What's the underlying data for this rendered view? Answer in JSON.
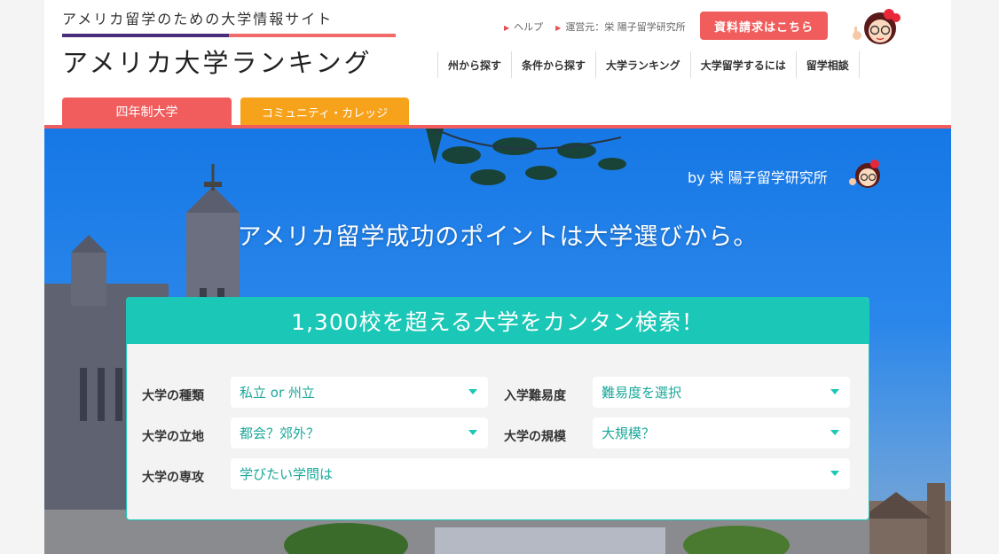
{
  "header": {
    "logo_sub": "アメリカ留学のための大学情報サイト",
    "logo_main": "アメリカ大学ランキング",
    "help_link": "ヘルプ",
    "operator_link": "運営元：栄 陽子留学研究所",
    "request_button": "資料請求はこちら"
  },
  "nav": {
    "items": [
      "州から探す",
      "条件から探す",
      "大学ランキング",
      "大学留学するには",
      "留学相談"
    ]
  },
  "tabs": {
    "university": "四年制大学",
    "community_college": "コミュニティ・カレッジ"
  },
  "hero": {
    "byline": "by 栄 陽子留学研究所",
    "tagline": "アメリカ留学成功のポイントは大学選びから。"
  },
  "search": {
    "title": "1,300校を超える大学をカンタン検索！",
    "type_label": "大学の種類",
    "type_value": "私立 or 州立",
    "difficulty_label": "入学難易度",
    "difficulty_value": "難易度を選択",
    "location_label": "大学の立地",
    "location_value": "都会？郊外？",
    "size_label": "大学の規模",
    "size_value": "大規模？",
    "major_label": "大学の専攻",
    "major_value": "学びたい学問は"
  },
  "colors": {
    "accent_red": "#f15d5d",
    "accent_orange": "#f7a21b",
    "accent_teal": "#1bc7b6",
    "logo_purple": "#4a2d7a"
  }
}
